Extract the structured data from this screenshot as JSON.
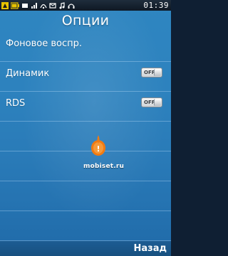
{
  "status_bar": {
    "time": "01:39",
    "icons": [
      "signal-icon",
      "battery-icon",
      "sms-icon",
      "network-icon",
      "mail-icon",
      "music-icon",
      "headphones-icon",
      "bluetooth-icon"
    ]
  },
  "header": {
    "title": "Опции"
  },
  "options": [
    {
      "label": "Фоновое воспр.",
      "has_toggle": false
    },
    {
      "label": "Динамик",
      "has_toggle": true,
      "toggle_text": "OFF",
      "state": "off"
    },
    {
      "label": "RDS",
      "has_toggle": true,
      "toggle_text": "OFF",
      "state": "off"
    }
  ],
  "watermark": {
    "text": "mobiset.ru"
  },
  "softkeys": {
    "right_label": "Назад"
  },
  "colors": {
    "background": "#2d82be",
    "status_bar": "#16202c",
    "accent_orange": "#f07a12"
  }
}
